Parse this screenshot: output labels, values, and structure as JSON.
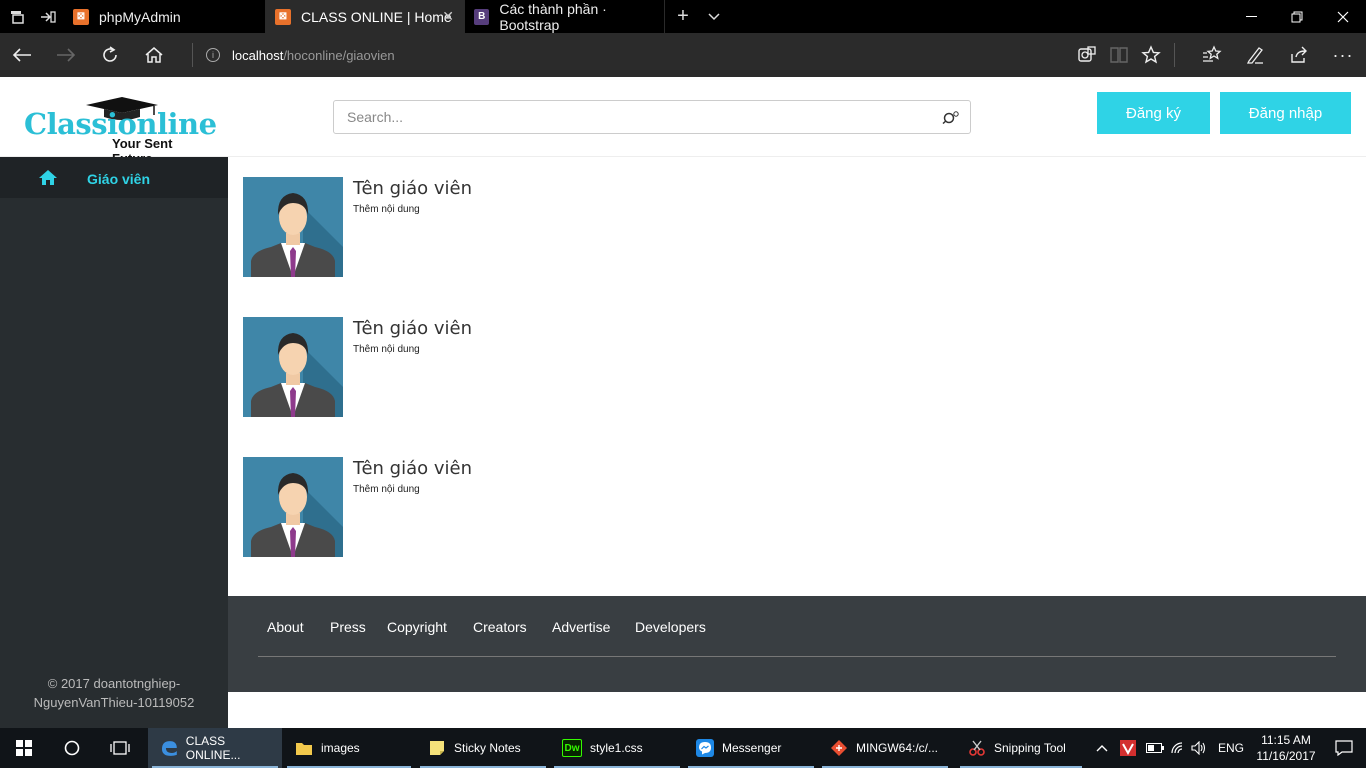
{
  "browser": {
    "tabs": [
      {
        "title": "phpMyAdmin",
        "icon": "xampp-icon"
      },
      {
        "title": "CLASS ONLINE | Home",
        "icon": "xampp-icon"
      },
      {
        "title": "Các thành phần · Bootstrap",
        "icon": "bootstrap-icon",
        "icon_letter": "B"
      }
    ],
    "url_host": "localhost",
    "url_path": "/hoconline/giaovien"
  },
  "site": {
    "logo_text": "Classionline",
    "logo_tagline": "Your Sent Future",
    "search_placeholder": "Search...",
    "register_label": "Đăng ký",
    "login_label": "Đăng nhập",
    "accent_color": "#2fd3e6"
  },
  "sidebar": {
    "items": [
      {
        "label": "Giáo viên",
        "icon": "home-icon"
      }
    ],
    "footer_line1": "© 2017 doantotnghiep-",
    "footer_line2": "NguyenVanThieu-10119052"
  },
  "teachers": [
    {
      "name": "Tên giáo viên",
      "desc": "Thêm nội dung"
    },
    {
      "name": "Tên giáo viên",
      "desc": "Thêm nội dung"
    },
    {
      "name": "Tên giáo viên",
      "desc": "Thêm nội dung"
    }
  ],
  "footer": {
    "links": [
      "About",
      "Press",
      "Copyright",
      "Creators",
      "Advertise",
      "Developers"
    ]
  },
  "taskbar": {
    "apps": [
      {
        "label": "CLASS ONLINE...",
        "icon": "edge-icon"
      },
      {
        "label": "images",
        "icon": "folder-icon"
      },
      {
        "label": "Sticky Notes",
        "icon": "sticky-notes-icon"
      },
      {
        "label": "style1.css",
        "icon": "dreamweaver-icon",
        "icon_letter": "Dw"
      },
      {
        "label": "Messenger",
        "icon": "messenger-icon"
      },
      {
        "label": "MINGW64:/c/...",
        "icon": "git-icon"
      },
      {
        "label": "Snipping Tool",
        "icon": "scissors-icon"
      }
    ],
    "language": "ENG",
    "time": "11:15 AM",
    "date": "11/16/2017"
  }
}
